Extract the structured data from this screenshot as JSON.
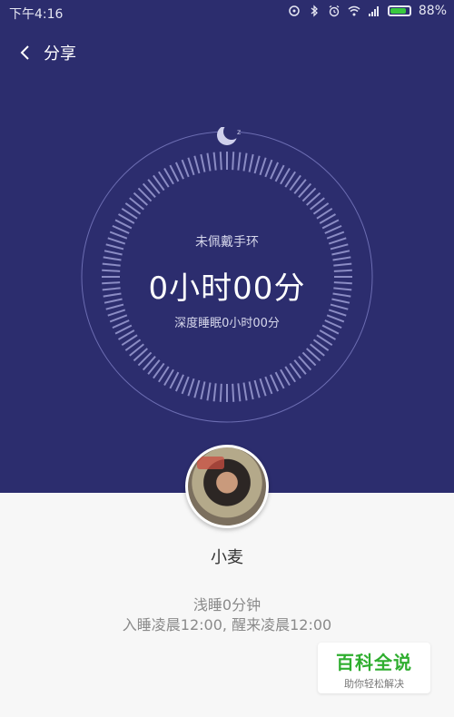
{
  "status_bar": {
    "time": "下午4:16",
    "battery": "88%",
    "battery_level": 0.88,
    "battery_color": "#39c93e"
  },
  "header": {
    "title": "分享"
  },
  "sleep_summary": {
    "device_status": "未佩戴手环",
    "total_time": "0小时00分",
    "deep_sleep": "深度睡眠0小时00分"
  },
  "user": {
    "name": "小麦"
  },
  "details": {
    "light_sleep": "浅睡0分钟",
    "sleep_wake": "入睡凌晨12:00, 醒来凌晨12:00"
  },
  "watermark": {
    "brand": "百科全说",
    "slogan": "助你轻松解决"
  },
  "colors": {
    "primary_bg": "#2c2d6e",
    "bottom_bg": "#f7f7f7"
  }
}
